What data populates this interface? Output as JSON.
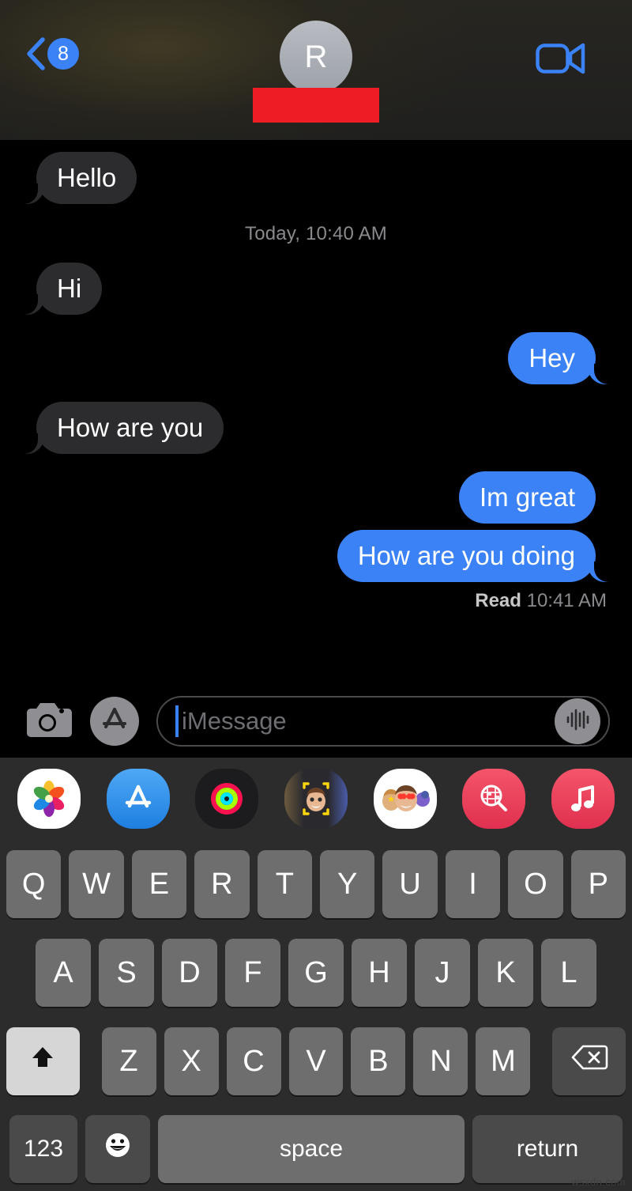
{
  "header": {
    "back_badge_count": "8",
    "back_icon": "chevron-left-icon",
    "avatar_initial": "R",
    "contact_name_redacted": "",
    "facetime_icon": "video-camera-icon",
    "redaction_color": "#EE1C25",
    "accent_color": "#3B82F6"
  },
  "conversation": {
    "messages": [
      {
        "id": "m1",
        "text": "Hello",
        "side": "in",
        "tail": true
      },
      {
        "id": "t1",
        "type": "timestamp",
        "text": "Today, 10:40 AM"
      },
      {
        "id": "m2",
        "text": "Hi",
        "side": "in",
        "tail": true
      },
      {
        "id": "m3",
        "text": "Hey",
        "side": "out",
        "tail": true
      },
      {
        "id": "m4",
        "text": "How are you",
        "side": "in",
        "tail": true
      },
      {
        "id": "m5",
        "text": "Im great",
        "side": "out",
        "tail": false
      },
      {
        "id": "m6",
        "text": "How are you doing",
        "side": "out",
        "tail": true
      }
    ],
    "read_receipt": {
      "label": "Read",
      "time": "10:41 AM"
    },
    "incoming_bubble_color": "#2C2C2E",
    "outgoing_bubble_color": "#3B82F6"
  },
  "input_bar": {
    "camera_icon": "camera-icon",
    "appstore_icon": "app-store-icon",
    "placeholder": "iMessage",
    "value": "",
    "audio_icon": "audio-waveform-icon"
  },
  "app_drawer": {
    "apps": [
      {
        "name": "photos-app-icon",
        "label": "Photos"
      },
      {
        "name": "app-store-app-icon",
        "label": "App Store"
      },
      {
        "name": "fitness-activity-app-icon",
        "label": "Fitness"
      },
      {
        "name": "memoji-app-icon",
        "label": "Memoji"
      },
      {
        "name": "animoji-stickers-app-icon",
        "label": "Animoji Stickers"
      },
      {
        "name": "images-search-app-icon",
        "label": "#images"
      },
      {
        "name": "apple-music-app-icon",
        "label": "Music"
      }
    ]
  },
  "keyboard": {
    "row1": [
      "Q",
      "W",
      "E",
      "R",
      "T",
      "Y",
      "U",
      "I",
      "O",
      "P"
    ],
    "row2": [
      "A",
      "S",
      "D",
      "F",
      "G",
      "H",
      "J",
      "K",
      "L"
    ],
    "row3": [
      "Z",
      "X",
      "C",
      "V",
      "B",
      "N",
      "M"
    ],
    "shift_label": "shift-up-arrow-icon",
    "backspace_label": "delete-backspace-icon",
    "numbers_label": "123",
    "emoji_label": "emoji-smiley-icon",
    "space_label": "space",
    "return_label": "return",
    "shift_active": true
  },
  "watermark": {
    "text": "wsxdn.com"
  }
}
